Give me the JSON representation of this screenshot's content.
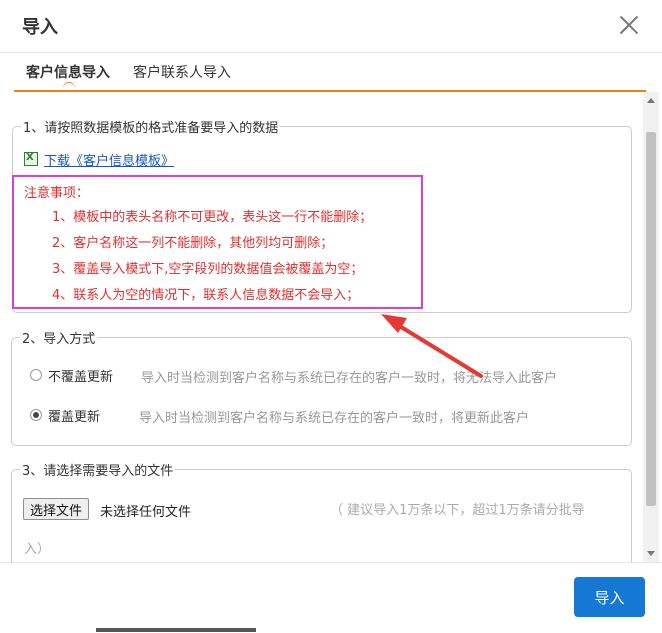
{
  "dialog": {
    "title": "导入",
    "close_icon": "close-icon"
  },
  "tabs": [
    {
      "label": "客户信息导入",
      "active": true
    },
    {
      "label": "客户联系人导入",
      "active": false
    }
  ],
  "section1": {
    "legend": "1、请按照数据模板的格式准备要导入的数据",
    "download_link": "下载《客户信息模板》",
    "download_icon": "excel-file-icon",
    "notice_title": "注意事项：",
    "notice_items": [
      "1、模板中的表头名称不可更改，表头这一行不能删除；",
      "2、客户名称这一列不能删除，其他列均可删除；",
      "3、覆盖导入模式下,空字段列的数据值会被覆盖为空；",
      "4、联系人为空的情况下，联系人信息数据不会导入；"
    ]
  },
  "section2": {
    "legend": "2、导入方式",
    "options": [
      {
        "label": "不覆盖更新",
        "desc": "导入时当检测到客户名称与系统已存在的客户一致时，将无法导入此客户",
        "checked": false
      },
      {
        "label": "覆盖更新",
        "desc": "导入时当检测到客户名称与系统已存在的客户一致时，将更新此客户",
        "checked": true
      }
    ]
  },
  "section3": {
    "legend": "3、请选择需要导入的文件",
    "file_button": "选择文件",
    "file_status": "未选择任何文件",
    "hint_line1": "（ 建议导入1万条以下，超过1万条请分批导",
    "hint_line2": "入）"
  },
  "footer": {
    "import_button": "导入"
  },
  "colors": {
    "accent": "#f07f1f",
    "primary_button": "#1478d4",
    "notice_text": "#e03030",
    "notice_border": "#d63fd8",
    "annotation_arrow": "#e53935"
  }
}
